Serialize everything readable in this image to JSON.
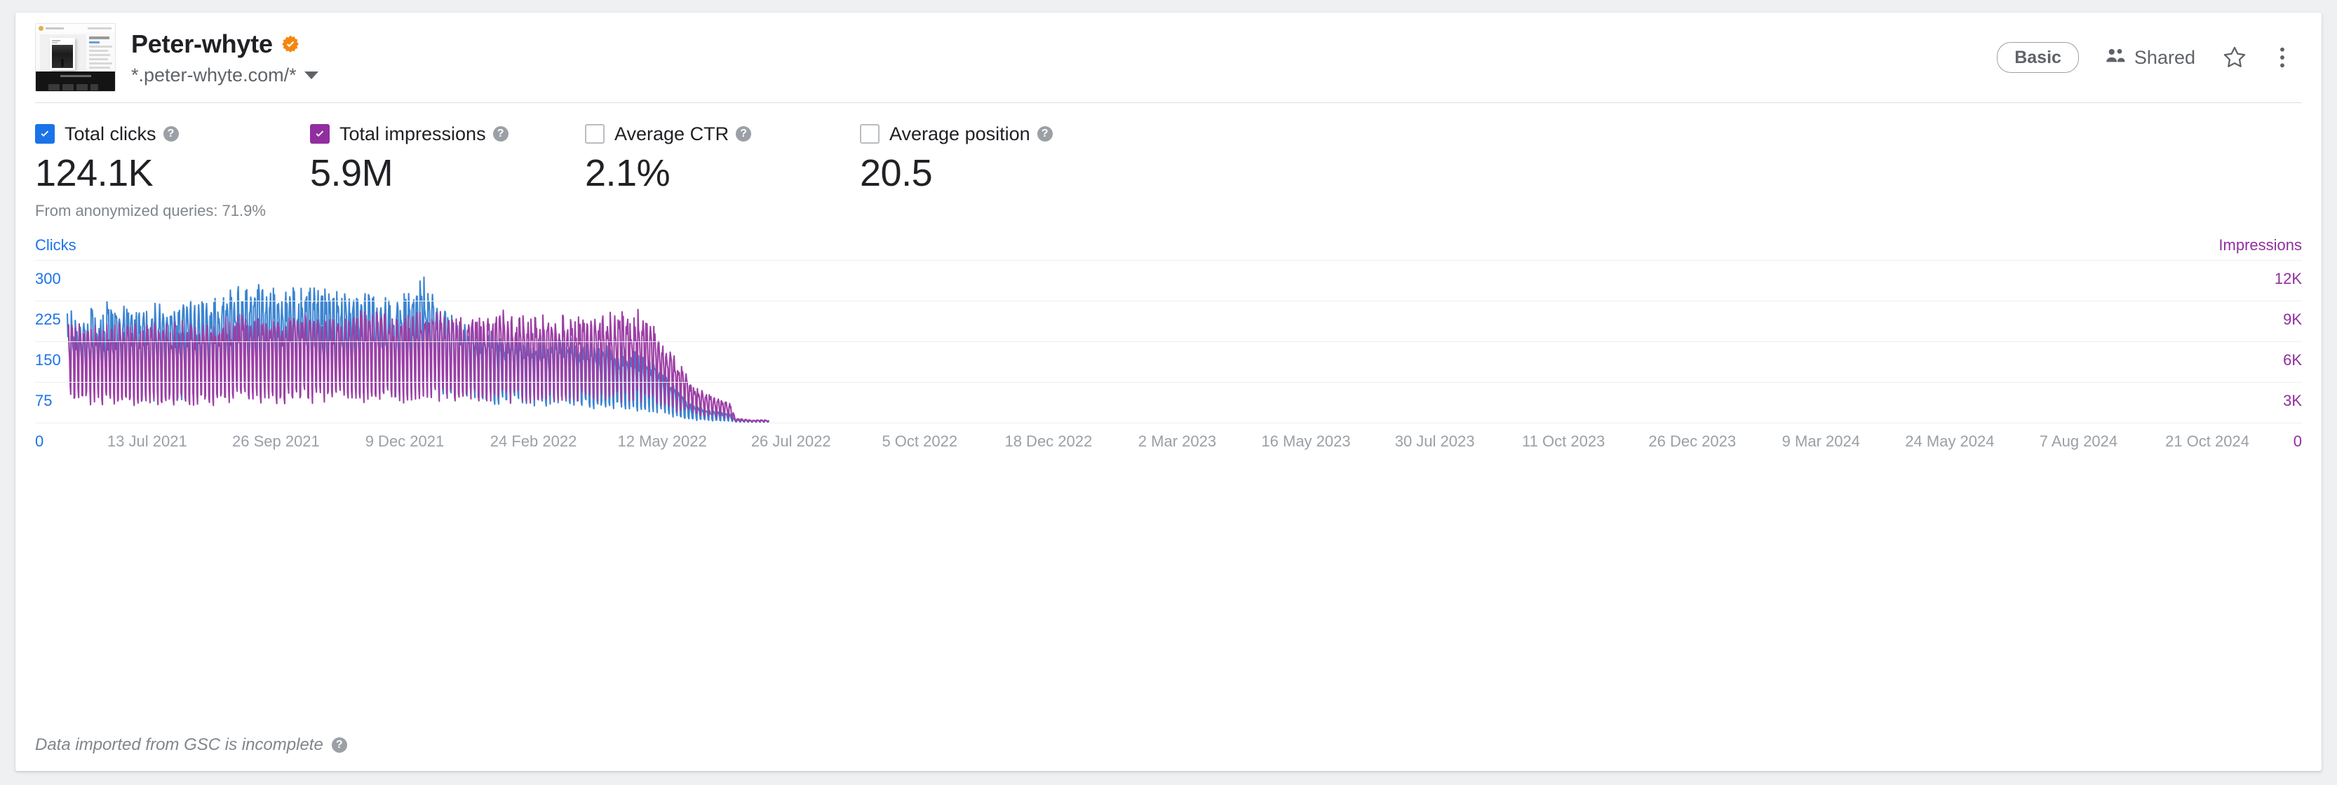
{
  "header": {
    "site_title": "Peter-whyte",
    "verified_badge": "verified-badge",
    "site_url": "*.peter-whyte.com/*",
    "plan_label": "Basic",
    "shared_label": "Shared",
    "star_icon": "star-icon",
    "more_icon": "more-vertical-icon",
    "accent_verified": "#f5860f"
  },
  "metrics": [
    {
      "id": "total-clicks",
      "label": "Total clicks",
      "value": "124.1K",
      "checked": true,
      "color": "#1a73e8"
    },
    {
      "id": "total-impressions",
      "label": "Total impressions",
      "value": "5.9M",
      "checked": true,
      "color": "#912ea0"
    },
    {
      "id": "average-ctr",
      "label": "Average CTR",
      "value": "2.1%",
      "checked": false,
      "color": "#00897b"
    },
    {
      "id": "average-position",
      "label": "Average position",
      "value": "20.5",
      "checked": false,
      "color": "#f9ab00"
    }
  ],
  "anonymized_note": "From anonymized queries: 71.9%",
  "footnote": "Data imported from GSC is incomplete",
  "help_glyph": "?",
  "chart_data": {
    "type": "line",
    "title": "",
    "xlabel": "",
    "grid": true,
    "legend": "none",
    "axes": {
      "left": {
        "name": "Clicks",
        "color": "#1a73e8",
        "ticks": [
          "300",
          "225",
          "150",
          "75",
          "0"
        ],
        "values": [
          300,
          225,
          150,
          75,
          0
        ],
        "ylim": [
          0,
          375
        ]
      },
      "right": {
        "name": "Impressions",
        "color": "#912ea0",
        "ticks": [
          "12K",
          "9K",
          "6K",
          "3K",
          "0"
        ],
        "values": [
          12000,
          9000,
          6000,
          3000,
          0
        ],
        "ylim": [
          0,
          15000
        ]
      }
    },
    "x_ticks": [
      "13 Jul 2021",
      "26 Sep 2021",
      "9 Dec 2021",
      "24 Feb 2022",
      "12 May 2022",
      "26 Jul 2022",
      "5 Oct 2022",
      "18 Dec 2022",
      "2 Mar 2023",
      "16 May 2023",
      "30 Jul 2023",
      "11 Oct 2023",
      "26 Dec 2023",
      "9 Mar 2024",
      "24 May 2024",
      "7 Aug 2024",
      "21 Oct 2024"
    ],
    "x_range": [
      "2021-06-10",
      "2024-11-20"
    ],
    "series": [
      {
        "name": "Clicks",
        "color": "#3b84d1",
        "axis": "left",
        "description": "Daily clicks with strong weekly seasonality; peaks ~200-310 through 2021-mid 2023, declining from late 2023 to near zero by Mar 2024.",
        "envelope": [
          {
            "t": 0.0,
            "peak": 228,
            "trough": 95
          },
          {
            "t": 0.03,
            "peak": 240,
            "trough": 80
          },
          {
            "t": 0.07,
            "peak": 258,
            "trough": 72
          },
          {
            "t": 0.11,
            "peak": 246,
            "trough": 66
          },
          {
            "t": 0.15,
            "peak": 272,
            "trough": 78
          },
          {
            "t": 0.19,
            "peak": 252,
            "trough": 70
          },
          {
            "t": 0.23,
            "peak": 288,
            "trough": 82
          },
          {
            "t": 0.27,
            "peak": 300,
            "trough": 88
          },
          {
            "t": 0.31,
            "peak": 278,
            "trough": 80
          },
          {
            "t": 0.35,
            "peak": 292,
            "trough": 84
          },
          {
            "t": 0.39,
            "peak": 268,
            "trough": 78
          },
          {
            "t": 0.43,
            "peak": 282,
            "trough": 80
          },
          {
            "t": 0.47,
            "peak": 258,
            "trough": 76
          },
          {
            "t": 0.51,
            "peak": 310,
            "trough": 86
          },
          {
            "t": 0.545,
            "peak": 232,
            "trough": 70
          },
          {
            "t": 0.58,
            "peak": 206,
            "trough": 62
          },
          {
            "t": 0.62,
            "peak": 188,
            "trough": 56
          },
          {
            "t": 0.66,
            "peak": 178,
            "trough": 50
          },
          {
            "t": 0.7,
            "peak": 186,
            "trough": 54
          },
          {
            "t": 0.74,
            "peak": 170,
            "trough": 46
          },
          {
            "t": 0.78,
            "peak": 160,
            "trough": 42
          },
          {
            "t": 0.815,
            "peak": 150,
            "trough": 38
          },
          {
            "t": 0.845,
            "peak": 112,
            "trough": 28
          },
          {
            "t": 0.87,
            "peak": 70,
            "trough": 16
          },
          {
            "t": 0.89,
            "peak": 38,
            "trough": 8
          },
          {
            "t": 0.905,
            "peak": 30,
            "trough": 6
          },
          {
            "t": 0.925,
            "peak": 24,
            "trough": 5
          },
          {
            "t": 0.945,
            "peak": 18,
            "trough": 4
          },
          {
            "t": 0.952,
            "peak": 6,
            "trough": 2
          },
          {
            "t": 0.975,
            "peak": 5,
            "trough": 1
          },
          {
            "t": 1.0,
            "peak": 5,
            "trough": 1
          }
        ]
      },
      {
        "name": "Impressions",
        "color": "#9c3fa5",
        "axis": "right",
        "description": "Daily impressions, same weekly pattern; rises to ~9-9.5K mid-2023 then collapses to near zero by Mar 2024.",
        "envelope": [
          {
            "t": 0.0,
            "peak": 8600,
            "trough": 2600
          },
          {
            "t": 0.03,
            "peak": 8200,
            "trough": 2300
          },
          {
            "t": 0.07,
            "peak": 8400,
            "trough": 2100
          },
          {
            "t": 0.11,
            "peak": 8300,
            "trough": 2000
          },
          {
            "t": 0.15,
            "peak": 8500,
            "trough": 2200
          },
          {
            "t": 0.19,
            "peak": 8300,
            "trough": 2100
          },
          {
            "t": 0.23,
            "peak": 8800,
            "trough": 2300
          },
          {
            "t": 0.27,
            "peak": 9000,
            "trough": 2500
          },
          {
            "t": 0.31,
            "peak": 8700,
            "trough": 2400
          },
          {
            "t": 0.35,
            "peak": 9100,
            "trough": 2500
          },
          {
            "t": 0.39,
            "peak": 8800,
            "trough": 2400
          },
          {
            "t": 0.43,
            "peak": 9400,
            "trough": 2600
          },
          {
            "t": 0.47,
            "peak": 9000,
            "trough": 2500
          },
          {
            "t": 0.51,
            "peak": 9600,
            "trough": 2700
          },
          {
            "t": 0.545,
            "peak": 9200,
            "trough": 2600
          },
          {
            "t": 0.58,
            "peak": 8900,
            "trough": 2500
          },
          {
            "t": 0.62,
            "peak": 9300,
            "trough": 2600
          },
          {
            "t": 0.66,
            "peak": 8800,
            "trough": 2400
          },
          {
            "t": 0.7,
            "peak": 9100,
            "trough": 2500
          },
          {
            "t": 0.74,
            "peak": 8900,
            "trough": 2400
          },
          {
            "t": 0.78,
            "peak": 9200,
            "trough": 2500
          },
          {
            "t": 0.815,
            "peak": 9400,
            "trough": 2600
          },
          {
            "t": 0.845,
            "peak": 7400,
            "trough": 2000
          },
          {
            "t": 0.87,
            "peak": 5400,
            "trough": 1400
          },
          {
            "t": 0.89,
            "peak": 3400,
            "trough": 900
          },
          {
            "t": 0.905,
            "peak": 2700,
            "trough": 700
          },
          {
            "t": 0.925,
            "peak": 2100,
            "trough": 600
          },
          {
            "t": 0.945,
            "peak": 1700,
            "trough": 500
          },
          {
            "t": 0.952,
            "peak": 400,
            "trough": 120
          },
          {
            "t": 0.975,
            "peak": 220,
            "trough": 80
          },
          {
            "t": 1.0,
            "peak": 220,
            "trough": 80
          }
        ]
      }
    ]
  }
}
